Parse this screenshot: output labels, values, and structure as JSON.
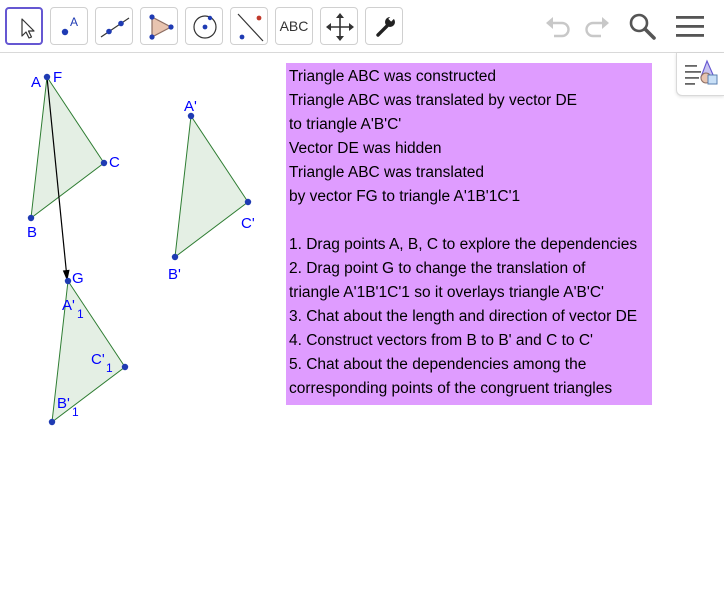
{
  "toolbar": {
    "tools": [
      {
        "name": "move-tool",
        "active": true
      },
      {
        "name": "point-tool"
      },
      {
        "name": "line-tool"
      },
      {
        "name": "polygon-tool"
      },
      {
        "name": "circle-tool"
      },
      {
        "name": "perpendicular-line-tool"
      },
      {
        "name": "text-tool",
        "label": "ABC"
      },
      {
        "name": "move-graphics-view-tool"
      },
      {
        "name": "tools-tool"
      }
    ],
    "icons": {
      "undo": "undo-icon",
      "redo": "redo-icon",
      "search": "search-icon",
      "menu": "hamburger-menu-icon",
      "style_bar": "style-bar-icon"
    },
    "accent_color": "#6557d2"
  },
  "geometry": {
    "colors": {
      "point": "#1f3bb3",
      "label": "#0000ff",
      "polygon_fill": "#e4efe4",
      "polygon_stroke": "#2e7d32",
      "vector": "#000000"
    },
    "labels": {
      "A": "A",
      "B": "B",
      "C": "C",
      "F": "F",
      "G": "G",
      "A_prime": "A'",
      "B_prime": "B'",
      "C_prime": "C'",
      "A_prime_1": "A'",
      "B_prime_1": "B'",
      "C_prime_1": "C'",
      "subscript": "1"
    }
  },
  "text_box": {
    "background": "#df9cff",
    "lines": [
      "Triangle ABC was constructed",
      "Triangle ABC was translated by vector DE",
      "to triangle A'B'C'",
      "Vector DE was hidden",
      "Triangle ABC was translated",
      "by vector FG to triangle A'1B'1C'1",
      "",
      "1. Drag points A, B, C to explore the dependencies",
      "2. Drag point G to change the translation of",
      "triangle A'1B'1C'1 so it overlays triangle A'B'C'",
      "3. Chat about the length and direction of vector DE",
      "4. Construct vectors from B to B' and C to C'",
      "5. Chat about the dependencies among the",
      "corresponding points of the congruent triangles"
    ]
  }
}
